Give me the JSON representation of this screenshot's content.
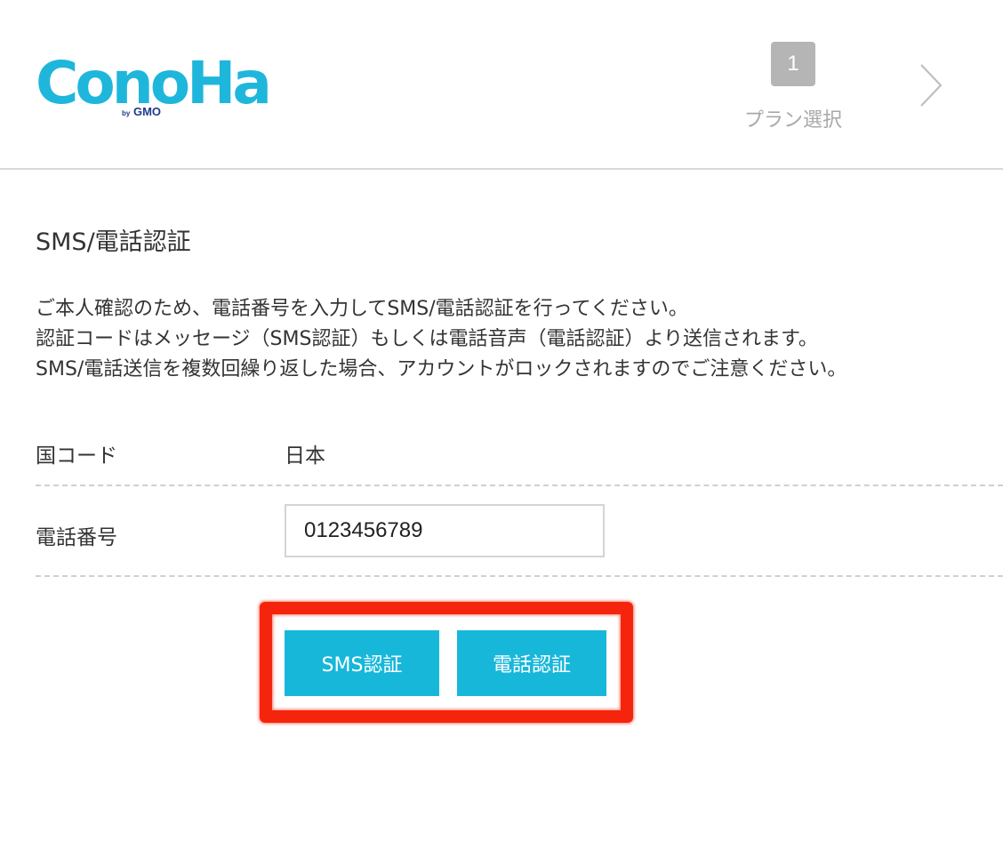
{
  "header": {
    "logo": {
      "text": "ConoHa",
      "by": "by",
      "brand": "GMO",
      "color": "#1fb6dc"
    },
    "steps": [
      {
        "number": "1",
        "label": "プラン選択"
      }
    ],
    "next_icon": "chevron-right-icon"
  },
  "main": {
    "title": "SMS/電話認証",
    "description": [
      "ご本人確認のため、電話番号を入力してSMS/電話認証を行ってください。",
      "認証コードはメッセージ（SMS認証）もしくは電話音声（電話認証）より送信されます。",
      "SMS/電話送信を複数回繰り返した場合、アカウントがロックされますのでご注意ください。"
    ],
    "form": {
      "country_label": "国コード",
      "country_value": "日本",
      "phone_label": "電話番号",
      "phone_value": "0123456789"
    },
    "buttons": {
      "sms_label": "SMS認証",
      "call_label": "電話認証",
      "color": "#17b7da"
    },
    "highlight_color": "#f4250c"
  }
}
